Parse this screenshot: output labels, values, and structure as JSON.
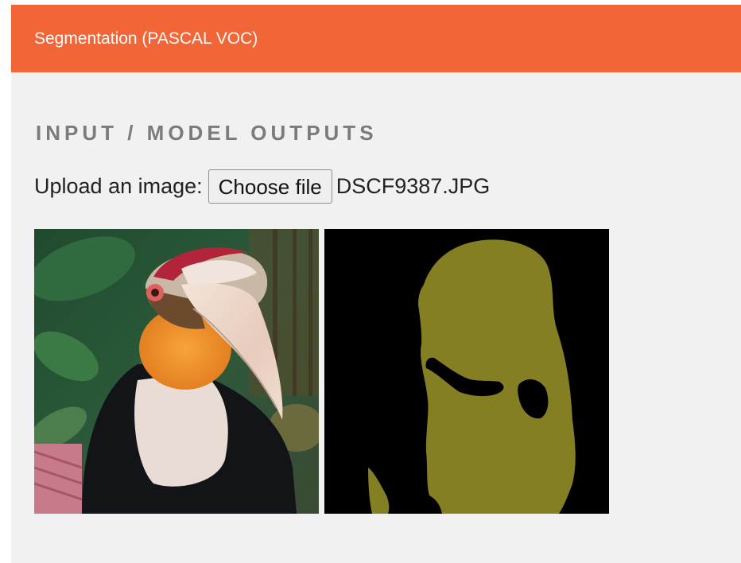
{
  "header": {
    "title": "Segmentation (PASCAL VOC)",
    "color": "#f26536"
  },
  "section": {
    "title": "INPUT / MODEL OUTPUTS"
  },
  "upload": {
    "label": "Upload an image:",
    "button_label": "Choose file",
    "file_name": "DSCF9387.JPG"
  },
  "images": {
    "input_image": "hornbill-photo",
    "output_image": "segmentation-mask",
    "mask_color": "#847f22",
    "background_color": "#000000"
  }
}
